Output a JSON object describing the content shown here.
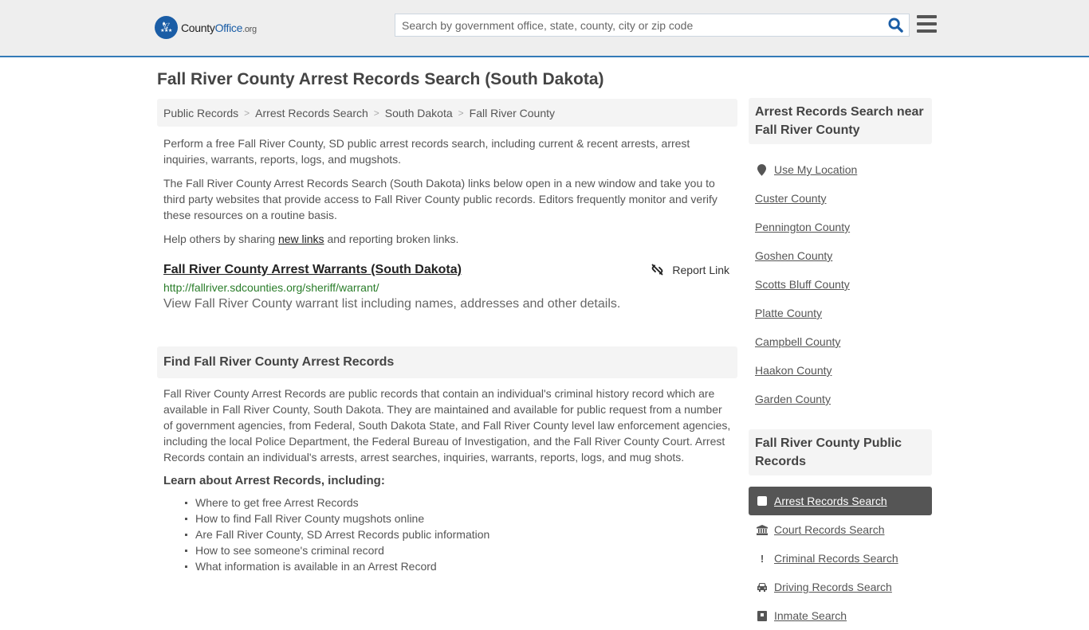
{
  "header": {
    "logo": {
      "name_part1": "County",
      "name_part2": "Office",
      "name_part3": ".org"
    },
    "search": {
      "placeholder": "Search by government office, state, county, city or zip code",
      "value": ""
    },
    "colors": {
      "brand": "#1a5da6",
      "header_bg": "#eeeeee",
      "header_border": "#337ab7"
    }
  },
  "page": {
    "title": "Fall River County Arrest Records Search (South Dakota)"
  },
  "breadcrumb": [
    {
      "label": "Public Records"
    },
    {
      "label": "Arrest Records Search"
    },
    {
      "label": "South Dakota"
    },
    {
      "label": "Fall River County"
    }
  ],
  "intro": {
    "p1": "Perform a free Fall River County, SD public arrest records search, including current & recent arrests, arrest inquiries, warrants, reports, logs, and mugshots.",
    "p2": "The Fall River County Arrest Records Search (South Dakota) links below open in a new window and take you to third party websites that provide access to Fall River County public records. Editors frequently monitor and verify these resources on a routine basis.",
    "p3_before": "Help others by sharing ",
    "p3_link": "new links",
    "p3_after": " and reporting broken links."
  },
  "results": [
    {
      "title": "Fall River County Arrest Warrants (South Dakota)",
      "url": "http://fallriver.sdcounties.org/sheriff/warrant/",
      "description": "View Fall River County warrant list including names, addresses and other details.",
      "report_label": "Report Link"
    }
  ],
  "find_section": {
    "heading": "Find Fall River County Arrest Records",
    "body": "Fall River County Arrest Records are public records that contain an individual's criminal history record which are available in Fall River County, South Dakota. They are maintained and available for public request from a number of government agencies, from Federal, South Dakota State, and Fall River County level law enforcement agencies, including the local Police Department, the Federal Bureau of Investigation, and the Fall River County Court. Arrest Records contain an individual's arrests, arrest searches, inquiries, warrants, reports, logs, and mug shots.",
    "learn_heading": "Learn about Arrest Records, including:",
    "learn_items": [
      "Where to get free Arrest Records",
      "How to find Fall River County mugshots online",
      "Are Fall River County, SD Arrest Records public information",
      "How to see someone's criminal record",
      "What information is available in an Arrest Record"
    ]
  },
  "sidebar": {
    "nearby_heading": "Arrest Records Search near Fall River County",
    "use_location": "Use My Location",
    "nearby": [
      "Custer County",
      "Pennington County",
      "Goshen County",
      "Scotts Bluff County",
      "Platte County",
      "Campbell County",
      "Haakon County",
      "Garden County"
    ],
    "public_records_heading": "Fall River County Public Records",
    "public_records": [
      {
        "label": "Arrest Records Search",
        "icon": "square-icon",
        "active": true
      },
      {
        "label": "Court Records Search",
        "icon": "courthouse-icon",
        "active": false
      },
      {
        "label": "Criminal Records Search",
        "icon": "exclamation-icon",
        "active": false
      },
      {
        "label": "Driving Records Search",
        "icon": "car-icon",
        "active": false
      },
      {
        "label": "Inmate Search",
        "icon": "inmate-icon",
        "active": false
      }
    ]
  }
}
